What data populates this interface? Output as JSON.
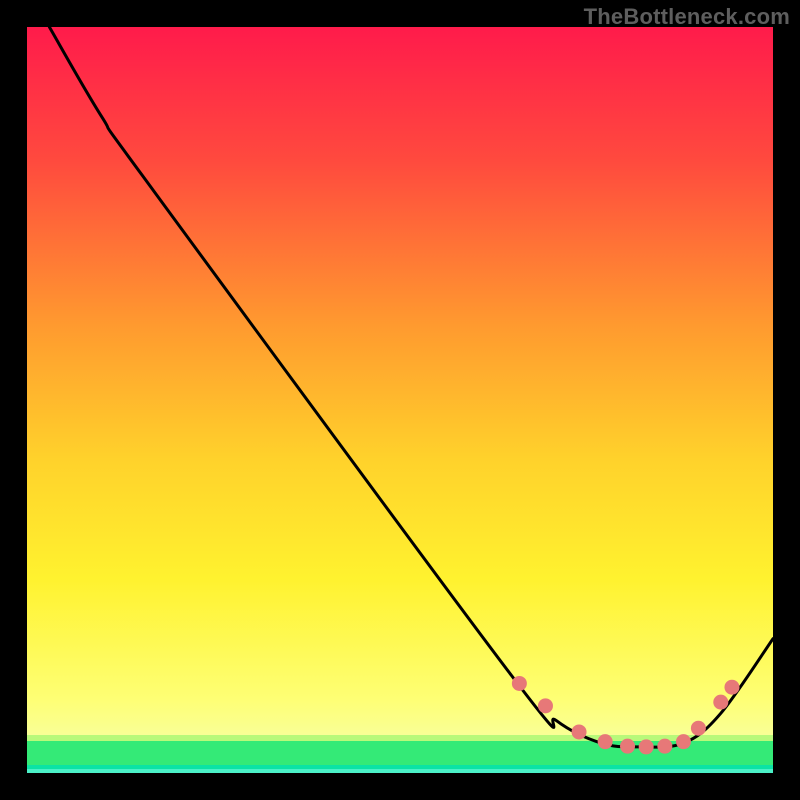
{
  "watermark": "TheBottleneck.com",
  "chart_data": {
    "type": "line",
    "title": "",
    "xlabel": "",
    "ylabel": "",
    "xlim": [
      0,
      100
    ],
    "ylim": [
      0,
      100
    ],
    "grid": false,
    "legend": false,
    "background_gradient": {
      "top_color": "#ff1b4b",
      "mid_color_upper": "#ffb12f",
      "mid_color_lower": "#fffb3a",
      "green_band": "#13e06a",
      "bottom_accent": "#0be3a5"
    },
    "series": [
      {
        "name": "curve",
        "color": "#000000",
        "x": [
          3,
          10,
          17,
          65,
          71,
          77,
          82,
          88,
          93,
          100
        ],
        "y": [
          100,
          88,
          78,
          13,
          7,
          4,
          3.5,
          4,
          8,
          18
        ]
      },
      {
        "name": "markers",
        "color": "#e77878",
        "marker": "circle",
        "x": [
          66,
          69.5,
          74,
          77.5,
          80.5,
          83,
          85.5,
          88,
          90,
          93,
          94.5
        ],
        "y": [
          12,
          9,
          5.5,
          4.2,
          3.6,
          3.5,
          3.6,
          4.2,
          6,
          9.5,
          11.5
        ]
      }
    ]
  }
}
